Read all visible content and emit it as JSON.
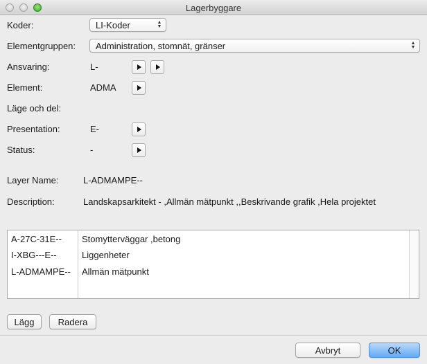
{
  "window": {
    "title": "Lagerbyggare"
  },
  "fields": {
    "koder": {
      "label": "Koder:",
      "value": "LI-Koder"
    },
    "elementgruppen": {
      "label": "Elementgruppen:",
      "value": "Administration, stomnät, gränser"
    },
    "ansvaring": {
      "label": "Ansvaring:",
      "value": "L-"
    },
    "element": {
      "label": "Element:",
      "value": "ADMA"
    },
    "lage": {
      "label": "Läge och del:",
      "value": ""
    },
    "presentation": {
      "label": "Presentation:",
      "value": "E-"
    },
    "status": {
      "label": "Status:",
      "value": "-"
    },
    "layer_name": {
      "label": "Layer Name:",
      "value": "L-ADMAMPE--"
    },
    "description": {
      "label": "Description:",
      "value": "Landskapsarkitekt - ,Allmän mätpunkt  ,,Beskrivande grafik  ,Hela projektet"
    }
  },
  "layers": [
    {
      "code": "A-27C-31E--",
      "desc": "Stomytterväggar  ,betong"
    },
    {
      "code": "I-XBG---E--",
      "desc": "Liggenheter"
    },
    {
      "code": "L-ADMAMPE--",
      "desc": "Allmän mätpunkt"
    }
  ],
  "buttons": {
    "add": "Lägg",
    "delete": "Radera",
    "cancel": "Avbryt",
    "ok": "OK"
  },
  "icons": {
    "popup_arrows": "updown-chevron-icon",
    "step": "play-right-icon"
  }
}
